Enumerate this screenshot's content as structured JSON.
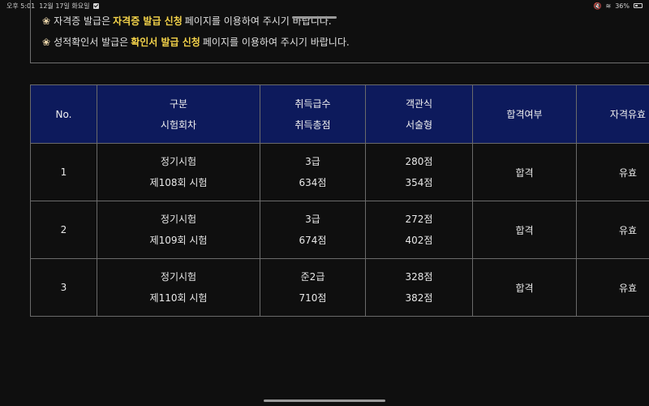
{
  "status_bar": {
    "time": "오후 5:01",
    "date": "12월 17일 화요일",
    "battery": "36%"
  },
  "notices": [
    {
      "prefix": "자격증 발급은",
      "highlight": "자격증 발급 신청",
      "suffix": "페이지를 이용하여 주시기 바랍니다."
    },
    {
      "prefix": "성적확인서 발급은",
      "highlight": "확인서 발급 신청",
      "suffix": "페이지를 이용하여 주시기 바랍니다."
    }
  ],
  "table": {
    "headers": [
      {
        "line1": "No.",
        "line2": ""
      },
      {
        "line1": "구분",
        "line2": "시험회차"
      },
      {
        "line1": "취득급수",
        "line2": "취득총점"
      },
      {
        "line1": "객관식",
        "line2": "서술형"
      },
      {
        "line1": "합격여부",
        "line2": ""
      },
      {
        "line1": "자격유효",
        "line2": ""
      }
    ],
    "rows": [
      {
        "no": "1",
        "type": "정기시험",
        "session": "제108회 시험",
        "grade": "3급",
        "total": "634점",
        "objective": "280점",
        "essay": "354점",
        "result": "합격",
        "validity": "유효"
      },
      {
        "no": "2",
        "type": "정기시험",
        "session": "제109회 시험",
        "grade": "3급",
        "total": "674점",
        "objective": "272점",
        "essay": "402점",
        "result": "합격",
        "validity": "유효"
      },
      {
        "no": "3",
        "type": "정기시험",
        "session": "제110회 시험",
        "grade": "준2급",
        "total": "710점",
        "objective": "328점",
        "essay": "382점",
        "result": "합격",
        "validity": "유효"
      }
    ]
  },
  "colors": {
    "background": "#0f0f0f",
    "header_bg": "#0d1a5c",
    "highlight": "#f4d34a"
  }
}
